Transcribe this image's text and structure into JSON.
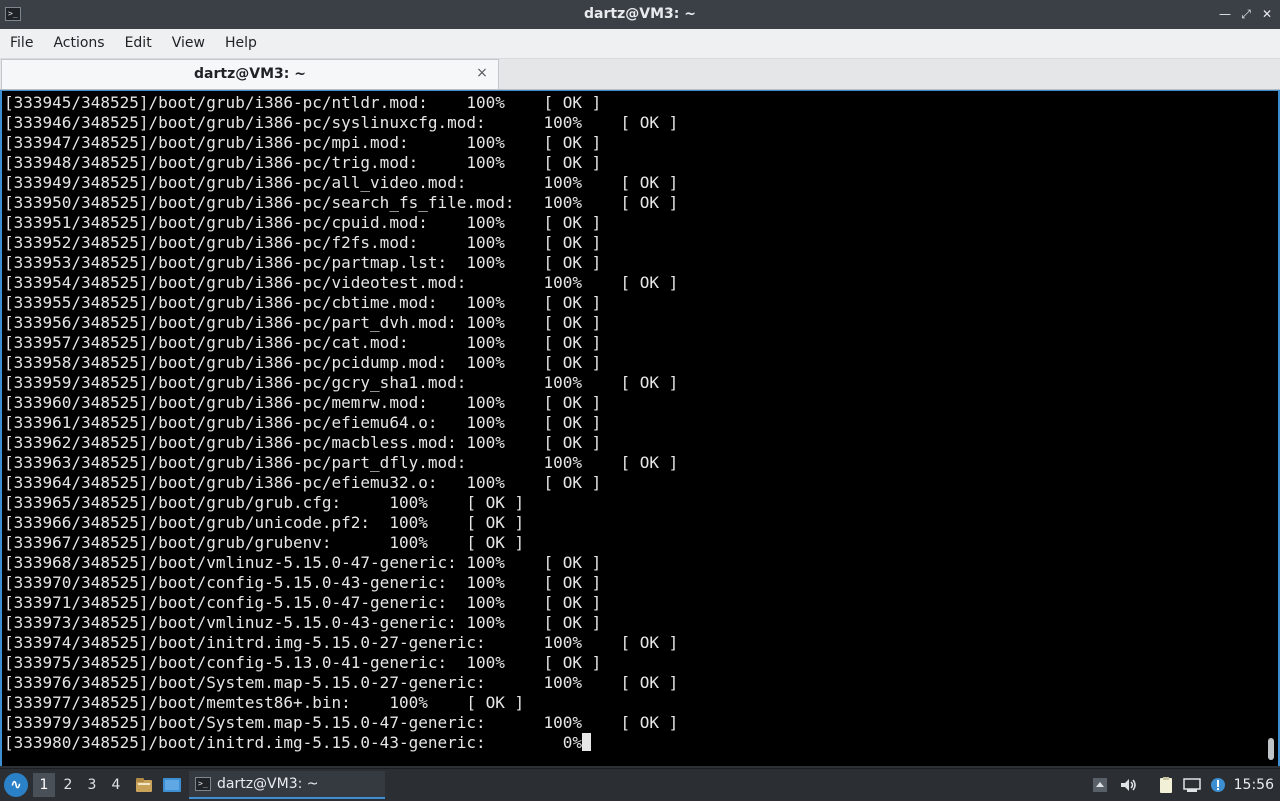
{
  "window": {
    "title": "dartz@VM3: ~",
    "icon": "terminal-icon"
  },
  "menu": [
    "File",
    "Actions",
    "Edit",
    "View",
    "Help"
  ],
  "tab": {
    "label": "dartz@VM3: ~",
    "close_glyph": "×"
  },
  "terminal": {
    "lines": [
      "[333945/348525]/boot/grub/i386-pc/ntldr.mod:    100%    [ OK ]",
      "[333946/348525]/boot/grub/i386-pc/syslinuxcfg.mod:      100%    [ OK ]",
      "[333947/348525]/boot/grub/i386-pc/mpi.mod:      100%    [ OK ]",
      "[333948/348525]/boot/grub/i386-pc/trig.mod:     100%    [ OK ]",
      "[333949/348525]/boot/grub/i386-pc/all_video.mod:        100%    [ OK ]",
      "[333950/348525]/boot/grub/i386-pc/search_fs_file.mod:   100%    [ OK ]",
      "[333951/348525]/boot/grub/i386-pc/cpuid.mod:    100%    [ OK ]",
      "[333952/348525]/boot/grub/i386-pc/f2fs.mod:     100%    [ OK ]",
      "[333953/348525]/boot/grub/i386-pc/partmap.lst:  100%    [ OK ]",
      "[333954/348525]/boot/grub/i386-pc/videotest.mod:        100%    [ OK ]",
      "[333955/348525]/boot/grub/i386-pc/cbtime.mod:   100%    [ OK ]",
      "[333956/348525]/boot/grub/i386-pc/part_dvh.mod: 100%    [ OK ]",
      "[333957/348525]/boot/grub/i386-pc/cat.mod:      100%    [ OK ]",
      "[333958/348525]/boot/grub/i386-pc/pcidump.mod:  100%    [ OK ]",
      "[333959/348525]/boot/grub/i386-pc/gcry_sha1.mod:        100%    [ OK ]",
      "[333960/348525]/boot/grub/i386-pc/memrw.mod:    100%    [ OK ]",
      "[333961/348525]/boot/grub/i386-pc/efiemu64.o:   100%    [ OK ]",
      "[333962/348525]/boot/grub/i386-pc/macbless.mod: 100%    [ OK ]",
      "[333963/348525]/boot/grub/i386-pc/part_dfly.mod:        100%    [ OK ]",
      "[333964/348525]/boot/grub/i386-pc/efiemu32.o:   100%    [ OK ]",
      "[333965/348525]/boot/grub/grub.cfg:     100%    [ OK ]",
      "[333966/348525]/boot/grub/unicode.pf2:  100%    [ OK ]",
      "[333967/348525]/boot/grub/grubenv:      100%    [ OK ]",
      "[333968/348525]/boot/vmlinuz-5.15.0-47-generic: 100%    [ OK ]",
      "[333970/348525]/boot/config-5.15.0-43-generic:  100%    [ OK ]",
      "[333971/348525]/boot/config-5.15.0-47-generic:  100%    [ OK ]",
      "[333973/348525]/boot/vmlinuz-5.15.0-43-generic: 100%    [ OK ]",
      "[333974/348525]/boot/initrd.img-5.15.0-27-generic:      100%    [ OK ]",
      "[333975/348525]/boot/config-5.13.0-41-generic:  100%    [ OK ]",
      "[333976/348525]/boot/System.map-5.15.0-27-generic:      100%    [ OK ]",
      "[333977/348525]/boot/memtest86+.bin:    100%    [ OK ]",
      "[333979/348525]/boot/System.map-5.15.0-47-generic:      100%    [ OK ]"
    ],
    "last_line": "[333980/348525]/boot/initrd.img-5.15.0-43-generic:        0%"
  },
  "taskbar": {
    "workspaces": [
      "1",
      "2",
      "3",
      "4"
    ],
    "active_workspace": "1",
    "task_label": "dartz@VM3: ~",
    "clock": "15:56",
    "accent": "#3d8fd1"
  }
}
